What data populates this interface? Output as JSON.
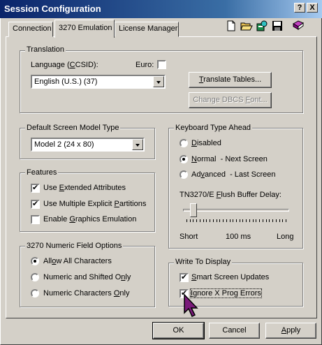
{
  "window": {
    "title": "Session Configuration",
    "help_btn": "?",
    "close_btn": "X"
  },
  "tabs": [
    {
      "label": "Connection",
      "active": false
    },
    {
      "label": "3270 Emulation",
      "active": true
    },
    {
      "label": "License Manager",
      "active": false
    }
  ],
  "toolbar": {
    "icons": [
      "new-document-icon",
      "open-folder-icon",
      "settings-icon",
      "save-icon",
      "book-icon"
    ]
  },
  "translation": {
    "legend": "Translation",
    "language_label_pre": "Language (",
    "language_label_u": "C",
    "language_label_post": "CSID):",
    "euro_label": "Euro:",
    "euro_checked": false,
    "language_value": "English (U.S.) (37)",
    "translate_tables_u": "T",
    "translate_tables_rest": "ranslate Tables...",
    "change_dbcs_pre": "Change DBCS ",
    "change_dbcs_u": "F",
    "change_dbcs_post": "ont..."
  },
  "screen_model": {
    "legend": "Default Screen Model Type",
    "value": "Model 2 (24 x 80)"
  },
  "features": {
    "legend": "Features",
    "items": [
      {
        "pre": "Use ",
        "u": "E",
        "post": "xtended Attributes",
        "checked": true
      },
      {
        "pre": "Use Multiple Explicit ",
        "u": "P",
        "post": "artitions",
        "checked": true
      },
      {
        "pre": "Enable ",
        "u": "G",
        "post": "raphics Emulation",
        "checked": false
      }
    ]
  },
  "numeric_field": {
    "legend": "3270 Numeric Field Options",
    "items": [
      {
        "pre": "All",
        "u": "o",
        "post": "w All Characters",
        "selected": true
      },
      {
        "pre": "Numeric and Shifted O",
        "u": "n",
        "post": "ly",
        "selected": false
      },
      {
        "pre": "Numeric Characters ",
        "u": "O",
        "post": "nly",
        "selected": false
      }
    ]
  },
  "keyboard": {
    "legend": "Keyboard Type Ahead",
    "options": [
      {
        "pre": "",
        "u": "D",
        "post": "isabled",
        "suffix": "",
        "selected": false
      },
      {
        "pre": "",
        "u": "N",
        "post": "ormal",
        "suffix": "-  Next Screen",
        "selected": true
      },
      {
        "pre": "Ad",
        "u": "v",
        "post": "anced",
        "suffix": "-  Last Screen",
        "selected": false
      }
    ],
    "flush_label_pre": "TN3270/E ",
    "flush_label_u": "F",
    "flush_label_post": "lush Buffer Delay:",
    "slider_value_fraction": 0.07,
    "scale_short": "Short",
    "scale_mid": "100 ms",
    "scale_long": "Long"
  },
  "write_display": {
    "legend": "Write To Display",
    "items": [
      {
        "pre": "",
        "u": "S",
        "post": "mart Screen Updates",
        "checked": true
      },
      {
        "pre": "",
        "u": "I",
        "post": "gnore X Prog Errors",
        "checked": true
      }
    ]
  },
  "buttons": {
    "ok": "OK",
    "cancel": "Cancel",
    "apply_u": "A",
    "apply_rest": "pply"
  }
}
